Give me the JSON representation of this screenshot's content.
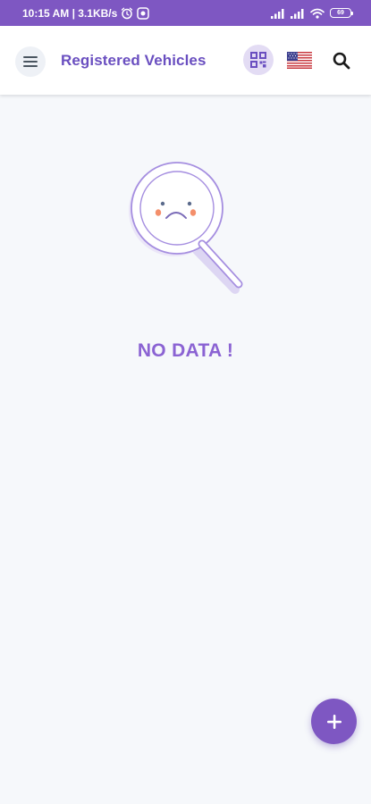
{
  "status_bar": {
    "time_and_speed": "10:15 AM | 3.1KB/s",
    "battery_level": "69"
  },
  "app_bar": {
    "title": "Registered Vehicles",
    "icons": {
      "menu": "hamburger-menu-icon",
      "qr": "qr-code-icon",
      "language": "us-flag-icon",
      "search": "search-icon"
    }
  },
  "empty_state": {
    "message": "NO DATA !",
    "illustration": "sad-magnifier-icon"
  },
  "fab": {
    "icon": "plus-icon"
  },
  "colors": {
    "primary": "#7e57c2",
    "title": "#6a4fc0",
    "empty_text": "#8b63d3",
    "background": "#f6f8fb"
  }
}
